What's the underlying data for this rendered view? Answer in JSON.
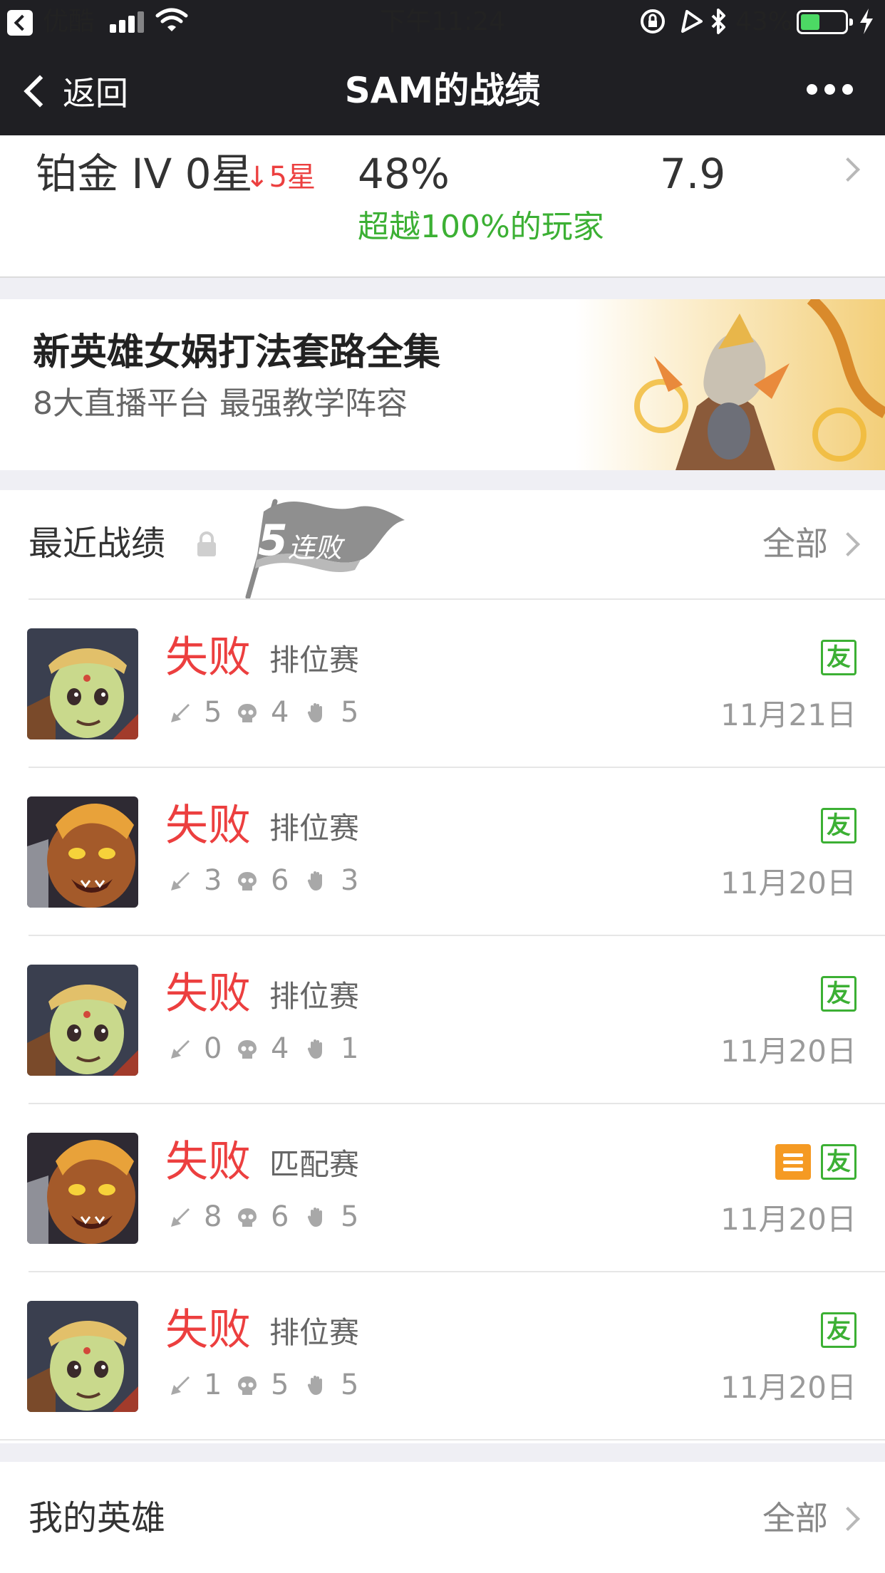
{
  "status_bar": {
    "back_app": "优酷",
    "time": "下午11:24",
    "battery_percent_text": "43%",
    "battery_level": 0.43
  },
  "nav": {
    "back_label": "返回",
    "title": "SAM的战绩"
  },
  "rank": {
    "tier": "铂金 IV 0星",
    "change": "↓5星",
    "win_rate": "48%",
    "beat": "超越100%的玩家",
    "score": "7.9"
  },
  "banner": {
    "title": "新英雄女娲打法套路全集",
    "subtitle": "8大直播平台 最强教学阵容"
  },
  "recent": {
    "title": "最近战绩",
    "streak_num": "5",
    "streak_label": "连败",
    "all_label": "全部",
    "matches": [
      {
        "result": "失败",
        "mode": "排位赛",
        "kills": "5",
        "deaths": "4",
        "assists": "5",
        "date": "11月21日",
        "tags": [
          "友"
        ],
        "hero": "ape"
      },
      {
        "result": "失败",
        "mode": "排位赛",
        "kills": "3",
        "deaths": "6",
        "assists": "3",
        "date": "11月20日",
        "tags": [
          "友"
        ],
        "hero": "monkey"
      },
      {
        "result": "失败",
        "mode": "排位赛",
        "kills": "0",
        "deaths": "4",
        "assists": "1",
        "date": "11月20日",
        "tags": [
          "友"
        ],
        "hero": "ape"
      },
      {
        "result": "失败",
        "mode": "匹配赛",
        "kills": "8",
        "deaths": "6",
        "assists": "5",
        "date": "11月20日",
        "tags": [
          "menu",
          "友"
        ],
        "hero": "monkey"
      },
      {
        "result": "失败",
        "mode": "排位赛",
        "kills": "1",
        "deaths": "5",
        "assists": "5",
        "date": "11月20日",
        "tags": [
          "友"
        ],
        "hero": "ape"
      }
    ]
  },
  "heroes": {
    "title": "我的英雄",
    "all_label": "全部"
  },
  "colors": {
    "nav_bg": "#1f1f23",
    "loss_red": "#ec3f3f",
    "friend_green": "#3cb034",
    "tag_orange": "#f59a23"
  }
}
